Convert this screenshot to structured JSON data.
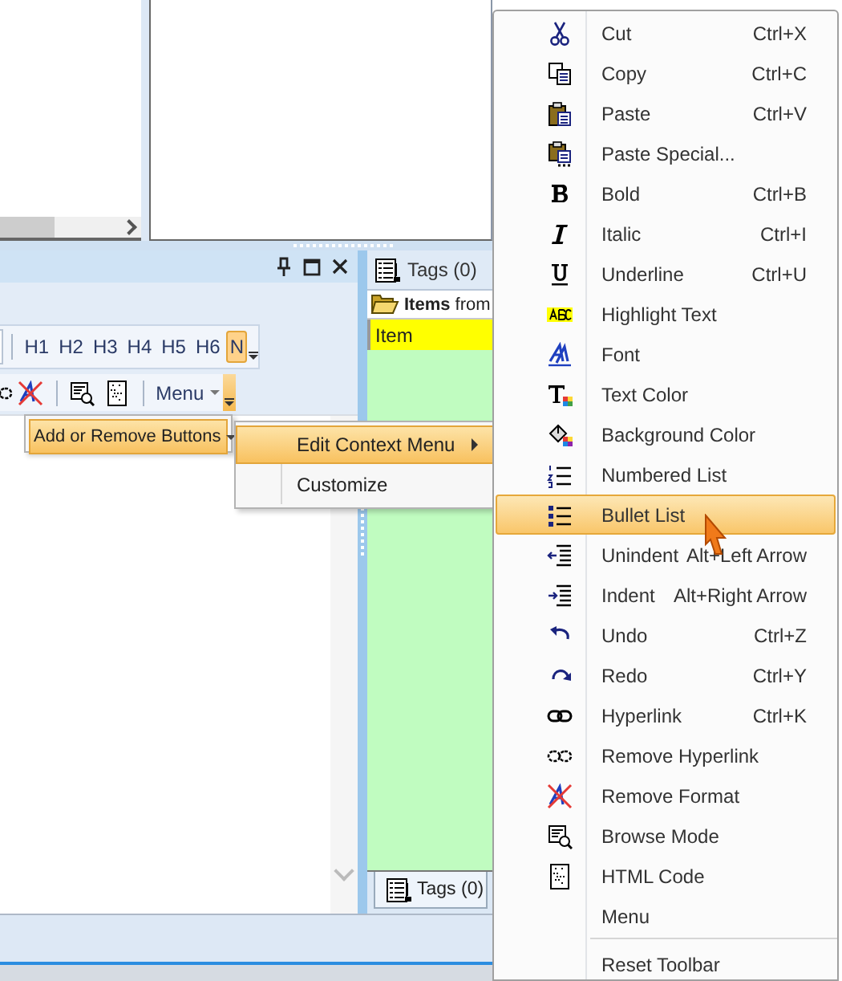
{
  "editor_panel": {
    "heading_toolbar": {
      "buttons": [
        {
          "label": "H1",
          "selected": false
        },
        {
          "label": "H2",
          "selected": false
        },
        {
          "label": "H3",
          "selected": false
        },
        {
          "label": "H4",
          "selected": false
        },
        {
          "label": "H5",
          "selected": false
        },
        {
          "label": "H6",
          "selected": false
        },
        {
          "label": "N",
          "selected": true
        }
      ],
      "overflow_pressed": false
    },
    "format_toolbar": {
      "menu_button": "Menu",
      "overflow_pressed": true
    }
  },
  "add_remove_popup": {
    "label": "Add or Remove Buttons",
    "selected": true
  },
  "customize_submenu": [
    {
      "label": "Edit Context Menu",
      "has_submenu": true,
      "selected": true
    },
    {
      "label": "Customize",
      "has_submenu": false,
      "selected": false
    }
  ],
  "tags_panel": {
    "title": "Tags (0)",
    "folder_row": "**Items** from",
    "column_header": "Item",
    "bottom_tab": {
      "label": "Tags (0)",
      "selected": true
    }
  },
  "context_menu": [
    {
      "kind": "item",
      "label": "Cut",
      "shortcut": "Ctrl+X",
      "selected": false
    },
    {
      "kind": "item",
      "label": "Copy",
      "shortcut": "Ctrl+C",
      "selected": false
    },
    {
      "kind": "item",
      "label": "Paste",
      "shortcut": "Ctrl+V",
      "selected": false
    },
    {
      "kind": "item",
      "label": "Paste Special...",
      "selected": false
    },
    {
      "kind": "item",
      "label": "Bold",
      "shortcut": "Ctrl+B",
      "selected": false
    },
    {
      "kind": "item",
      "label": "Italic",
      "shortcut": "Ctrl+I",
      "selected": false
    },
    {
      "kind": "item",
      "label": "Underline",
      "shortcut": "Ctrl+U",
      "selected": false
    },
    {
      "kind": "item",
      "label": "Highlight Text",
      "selected": false
    },
    {
      "kind": "item",
      "label": "Font",
      "selected": false
    },
    {
      "kind": "item",
      "label": "Text Color",
      "selected": false
    },
    {
      "kind": "item",
      "label": "Background Color",
      "selected": false
    },
    {
      "kind": "item",
      "label": "Numbered List",
      "selected": false
    },
    {
      "kind": "item",
      "label": "Bullet List",
      "selected": true
    },
    {
      "kind": "item",
      "label": "Unindent",
      "shortcut": "Alt+Left Arrow",
      "selected": false
    },
    {
      "kind": "item",
      "label": "Indent",
      "shortcut": "Alt+Right Arrow",
      "selected": false
    },
    {
      "kind": "item",
      "label": "Undo",
      "shortcut": "Ctrl+Z",
      "selected": false
    },
    {
      "kind": "item",
      "label": "Redo",
      "shortcut": "Ctrl+Y",
      "selected": false
    },
    {
      "kind": "item",
      "label": "Hyperlink",
      "shortcut": "Ctrl+K",
      "selected": false
    },
    {
      "kind": "item",
      "label": "Remove Hyperlink",
      "selected": false
    },
    {
      "kind": "item",
      "label": "Remove Format",
      "selected": false
    },
    {
      "kind": "item",
      "label": "Browse Mode",
      "selected": false
    },
    {
      "kind": "item",
      "label": "HTML Code",
      "selected": false
    },
    {
      "kind": "item",
      "label": "Menu",
      "selected": false
    },
    {
      "kind": "separator"
    },
    {
      "kind": "item",
      "label": "Reset Toolbar",
      "selected": false
    }
  ]
}
